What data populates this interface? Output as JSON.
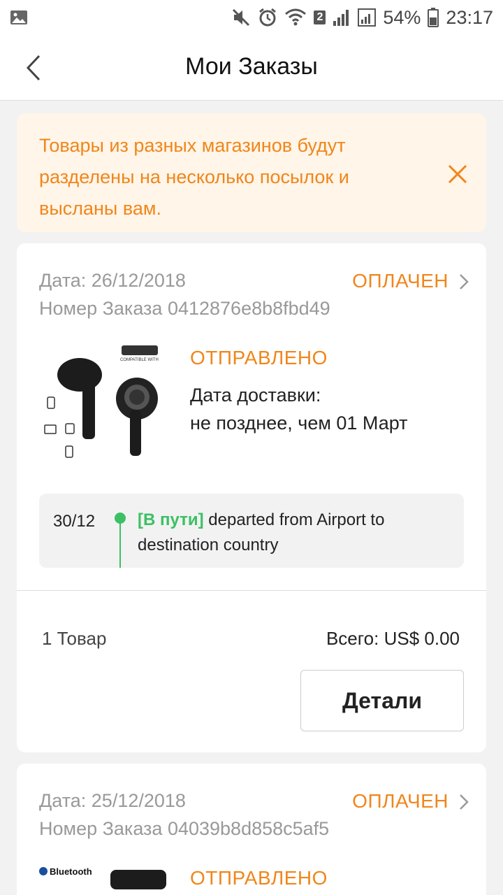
{
  "status_bar": {
    "battery_percent": "54%",
    "time": "23:17",
    "sim_badge": "2",
    "icons": [
      "image-icon",
      "mute-icon",
      "alarm-icon",
      "wifi-icon",
      "signal-icon",
      "battery-icon"
    ]
  },
  "header": {
    "title": "Мои Заказы"
  },
  "notice": {
    "text": "Товары из разных магазинов будут разделены на несколько посылок и высланы вам.",
    "color": "#f0861a",
    "background": "#fff5e9"
  },
  "orders": [
    {
      "date": "Дата: 26/12/2018",
      "number": "Номер Заказа 0412876e8b8fbd49",
      "status": "ОПЛАЧЕН",
      "shipping_status": "ОТПРАВЛЕНО",
      "delivery_label": "Дата доставки:",
      "delivery_value": "не позднее, чем 01 Март",
      "image_text": "COMPATIBLE WITH",
      "tracking": {
        "date": "30/12",
        "tag": "[В пути]",
        "text": " departed from Airport to destination country"
      },
      "item_count": "1 Товар",
      "total": "Всего: US$ 0.00",
      "details_label": "Детали"
    },
    {
      "date": "Дата: 25/12/2018",
      "number": "Номер Заказа 04039b8d858c5af5",
      "status": "ОПЛАЧЕН",
      "shipping_status": "ОТПРАВЛЕНО",
      "image_text": "Bluetooth"
    }
  ],
  "colors": {
    "accent_orange": "#f0861a",
    "transit_green": "#3cc065"
  }
}
